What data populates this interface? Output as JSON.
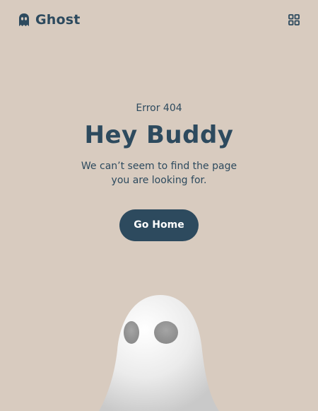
{
  "header": {
    "brand": "Ghost",
    "icons": {
      "logo": "ghost-icon",
      "menu": "grid-icon"
    }
  },
  "main": {
    "error_code": "Error 404",
    "title": "Hey Buddy",
    "message": "We can’t seem to find the page you are looking for.",
    "button_label": "Go Home"
  },
  "colors": {
    "background": "#d8cbbf",
    "primary": "#2d4a5e",
    "button_text": "#ffffff",
    "ghost_body": "#f2f2f2",
    "ghost_eyes": "#9a9a9a"
  }
}
